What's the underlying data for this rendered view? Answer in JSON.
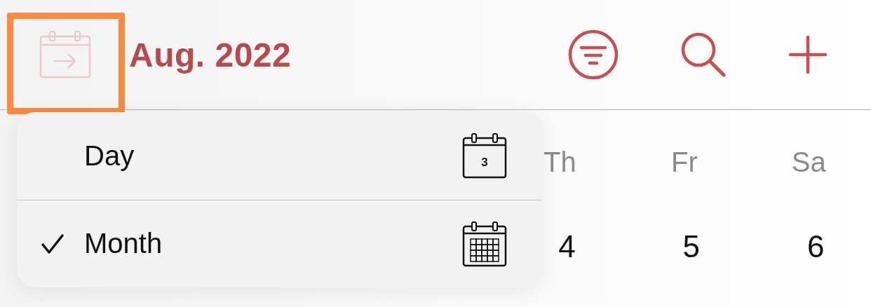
{
  "header": {
    "today_button": {
      "highlighted": true
    },
    "title": "Aug. 2022"
  },
  "weekdays": [
    {
      "label": "Th"
    },
    {
      "label": "Fr"
    },
    {
      "label": "Sa"
    }
  ],
  "dates": [
    "4",
    "5",
    "6"
  ],
  "menu": {
    "items": [
      {
        "label": "Day",
        "checked": false,
        "kind": "day",
        "icon_text": "3"
      },
      {
        "label": "Month",
        "checked": true,
        "kind": "month"
      }
    ]
  }
}
